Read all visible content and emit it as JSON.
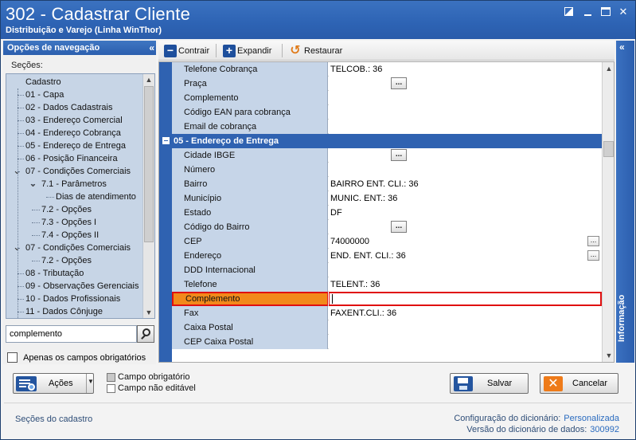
{
  "window": {
    "title": "302 - Cadastrar Cliente",
    "subtitle": "Distribuição e Varejo (Linha WinThor)"
  },
  "nav": {
    "header": "Opções de navegação",
    "sections_label": "Seções:",
    "tree": [
      {
        "label": "Cadastro",
        "level": 0,
        "toggle": ""
      },
      {
        "label": "01 - Capa",
        "level": 1,
        "toggle": ""
      },
      {
        "label": "02 - Dados Cadastrais",
        "level": 1,
        "toggle": ""
      },
      {
        "label": "03 - Endereço Comercial",
        "level": 1,
        "toggle": ""
      },
      {
        "label": "04 - Endereço Cobrança",
        "level": 1,
        "toggle": ""
      },
      {
        "label": "05 - Endereço de Entrega",
        "level": 1,
        "toggle": ""
      },
      {
        "label": "06 - Posição Financeira",
        "level": 1,
        "toggle": ""
      },
      {
        "label": "07 - Condições Comerciais",
        "level": 1,
        "toggle": "expanded"
      },
      {
        "label": "7.1 - Parâmetros",
        "level": 2,
        "toggle": "expanded"
      },
      {
        "label": "Dias de atendimento",
        "level": 3,
        "toggle": ""
      },
      {
        "label": "7.2 - Opções",
        "level": 2,
        "toggle": ""
      },
      {
        "label": "7.3 - Opções I",
        "level": 2,
        "toggle": ""
      },
      {
        "label": "7.4 - Opções II",
        "level": 2,
        "toggle": ""
      },
      {
        "label": "07 - Condições Comerciais",
        "level": 1,
        "toggle": "expanded"
      },
      {
        "label": "7.2 - Opções",
        "level": 2,
        "toggle": ""
      },
      {
        "label": "08 - Tributação",
        "level": 1,
        "toggle": ""
      },
      {
        "label": "09 - Observações Gerenciais",
        "level": 1,
        "toggle": ""
      },
      {
        "label": "10 - Dados Profissionais",
        "level": 1,
        "toggle": ""
      },
      {
        "label": "11 - Dados Cônjuge",
        "level": 1,
        "toggle": ""
      }
    ],
    "search_value": "complemento",
    "only_required_label": "Apenas os campos obrigatórios"
  },
  "toolbar": {
    "collapse_label": "Contrair",
    "expand_label": "Expandir",
    "restore_label": "Restaurar"
  },
  "grid": {
    "rows": [
      {
        "type": "field",
        "name": "Telefone Cobrança",
        "value": "TELCOB.: 36",
        "button": ""
      },
      {
        "type": "field",
        "name": "Praça",
        "value": "",
        "button": "large"
      },
      {
        "type": "field",
        "name": "Complemento",
        "value": "",
        "button": ""
      },
      {
        "type": "field",
        "name": "Código EAN para cobrança",
        "value": "",
        "button": ""
      },
      {
        "type": "field",
        "name": "Email de cobrança",
        "value": "",
        "button": ""
      },
      {
        "type": "section",
        "name": "05 - Endereço de Entrega"
      },
      {
        "type": "field",
        "name": "Cidade IBGE",
        "value": "",
        "button": "large"
      },
      {
        "type": "field",
        "name": "Número",
        "value": "",
        "button": ""
      },
      {
        "type": "field",
        "name": "Bairro",
        "value": "BAIRRO ENT. CLI.: 36",
        "button": ""
      },
      {
        "type": "field",
        "name": "Município",
        "value": "MUNIC. ENT.: 36",
        "button": ""
      },
      {
        "type": "field",
        "name": "Estado",
        "value": "DF",
        "button": ""
      },
      {
        "type": "field",
        "name": "Código do Bairro",
        "value": "",
        "button": "large"
      },
      {
        "type": "field",
        "name": "CEP",
        "value": "74000000",
        "button": "small"
      },
      {
        "type": "field",
        "name": "Endereço",
        "value": "END. ENT. CLI.: 36",
        "button": "small"
      },
      {
        "type": "field",
        "name": "DDD Internacional",
        "value": "",
        "button": ""
      },
      {
        "type": "field",
        "name": "Telefone",
        "value": "TELENT.: 36",
        "button": ""
      },
      {
        "type": "field",
        "name": "Complemento",
        "value": "",
        "button": "",
        "highlight": true
      },
      {
        "type": "field",
        "name": "Fax",
        "value": "FAXENT.CLI.: 36",
        "button": ""
      },
      {
        "type": "field",
        "name": "Caixa Postal",
        "value": "",
        "button": ""
      },
      {
        "type": "field",
        "name": "CEP Caixa Postal",
        "value": "",
        "button": ""
      }
    ],
    "ellipsis": "..."
  },
  "info_panel": {
    "label": "Informação"
  },
  "bottom": {
    "actions_label": "Ações",
    "legend_required": "Campo obrigatório",
    "legend_not_editable": "Campo não editável",
    "save_label": "Salvar",
    "cancel_label": "Cancelar"
  },
  "status": {
    "left": "Seções do cadastro",
    "dictionary_config_label": "Configuração do dicionário:",
    "dictionary_config_value": "Personalizada",
    "dictionary_version_label": "Versão do dicionário de dados:",
    "dictionary_version_value": "300992"
  },
  "colors": {
    "title_bar": "#2d63b4",
    "section_blue": "#2f62b1",
    "field_label_bg": "#c6d5e8",
    "highlight_orange": "#f2891a",
    "highlight_border": "#e01010"
  },
  "icons": {
    "collapse": "minus-square-icon",
    "expand": "plus-square-icon",
    "restore": "undo-arrow-icon",
    "search": "magnifier-icon",
    "save": "floppy-disk-icon",
    "cancel": "x-icon",
    "actions": "list-gear-icon"
  }
}
